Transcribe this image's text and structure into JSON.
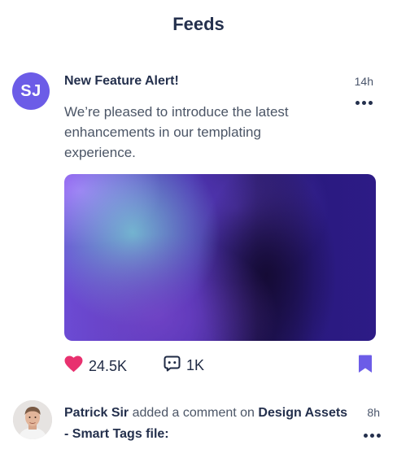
{
  "header": {
    "title": "Feeds"
  },
  "post1": {
    "avatar_initials": "SJ",
    "title": "New Feature Alert!",
    "time": "14h",
    "body": "We’re pleased to introduce the latest enhancements in our templating experience.",
    "likes": "24.5K",
    "comments": "1K",
    "colors": {
      "avatar": "#6c5ce7",
      "like": "#e8316f",
      "bookmark": "#6c5ce7"
    },
    "icons": [
      "heart-icon",
      "comment-icon",
      "bookmark-icon",
      "more-icon"
    ]
  },
  "post2": {
    "author": "Patrick Sir",
    "action": "added a comment on",
    "target": "Design Assets - Smart Tags file:",
    "time": "8h"
  }
}
